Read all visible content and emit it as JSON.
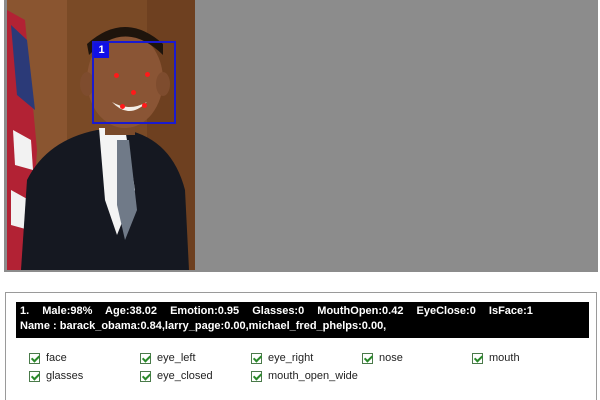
{
  "detection": {
    "face_id": "1",
    "line1": {
      "index": "1.",
      "male": "Male:98%",
      "age": "Age:38.02",
      "emotion": "Emotion:0.95",
      "glasses": "Glasses:0",
      "mouth_open": "MouthOpen:0.42",
      "eye_close": "EyeClose:0",
      "is_face": "IsFace:1"
    },
    "line2": "Name : barack_obama:0.84,larry_page:0.00,michael_fred_phelps:0.00,"
  },
  "options": [
    {
      "label": "face",
      "checked": true
    },
    {
      "label": "eye_left",
      "checked": true
    },
    {
      "label": "eye_right",
      "checked": true
    },
    {
      "label": "nose",
      "checked": true
    },
    {
      "label": "mouth",
      "checked": true
    },
    {
      "label": "glasses",
      "checked": true
    },
    {
      "label": "eye_closed",
      "checked": true
    },
    {
      "label": "mouth_open_wide",
      "checked": true
    }
  ],
  "colors": {
    "viewer_bg": "#8c8c8c",
    "face_box": "#1a1ad0",
    "landmark": "#ff1a1a",
    "result_bg": "#000000",
    "checkbox_check": "#2a8a2a"
  }
}
